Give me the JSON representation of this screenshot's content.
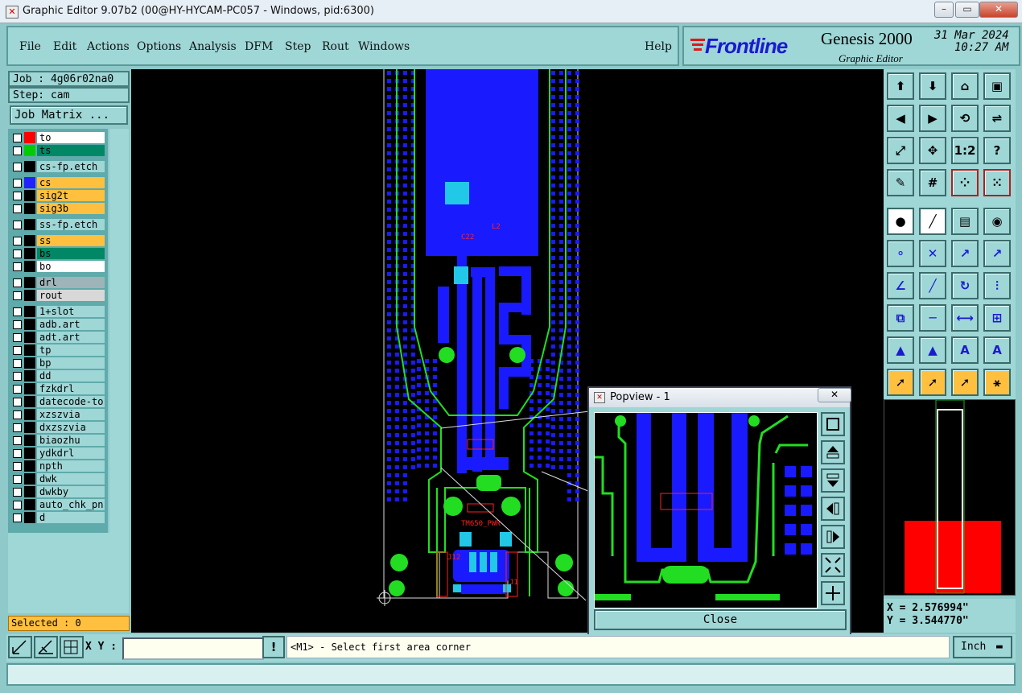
{
  "window": {
    "title": "Graphic Editor 9.07b2 (00@HY-HYCAM-PC057 - Windows, pid:6300)"
  },
  "menu": {
    "items": [
      "File",
      "Edit",
      "Actions",
      "Options",
      "Analysis",
      "DFM",
      "Step",
      "Rout",
      "Windows"
    ],
    "help": "Help"
  },
  "brand": {
    "logo": "Frontline",
    "product": "Genesis 2000",
    "subtitle": "Graphic Editor",
    "date": "31 Mar 2024",
    "time": "10:27 AM"
  },
  "job": {
    "job_label": "Job : 4g06r02na0",
    "step_label": "Step: cam",
    "matrix_button": "Job Matrix ..."
  },
  "layers": [
    {
      "name": "to",
      "swatch": "#ff0000",
      "bg": "#ffffff"
    },
    {
      "name": "ts",
      "swatch": "#00cc00",
      "bg": "#008866"
    },
    {
      "name": "cs-fp.etch",
      "swatch": "#000000",
      "bg": "#9fd6d6"
    },
    {
      "name": "cs",
      "swatch": "#2222ff",
      "bg": "#ffc040"
    },
    {
      "name": "sig2t",
      "swatch": "#000000",
      "bg": "#ffc040"
    },
    {
      "name": "sig3b",
      "swatch": "#000000",
      "bg": "#ffc040"
    },
    {
      "name": "ss-fp.etch",
      "swatch": "#000000",
      "bg": "#9fd6d6"
    },
    {
      "name": "ss",
      "swatch": "#000000",
      "bg": "#ffc040"
    },
    {
      "name": "bs",
      "swatch": "#000000",
      "bg": "#008866"
    },
    {
      "name": "bo",
      "swatch": "#000000",
      "bg": "#ffffff"
    },
    {
      "name": "drl",
      "swatch": "#000000",
      "bg": "#9fb4b8"
    },
    {
      "name": "rout",
      "swatch": "#000000",
      "bg": "#d8d8d8"
    },
    {
      "name": "1+slot",
      "swatch": "#000000",
      "bg": "#9fd6d6"
    },
    {
      "name": "adb.art",
      "swatch": "#000000",
      "bg": "#9fd6d6"
    },
    {
      "name": "adt.art",
      "swatch": "#000000",
      "bg": "#9fd6d6"
    },
    {
      "name": "tp",
      "swatch": "#000000",
      "bg": "#9fd6d6"
    },
    {
      "name": "bp",
      "swatch": "#000000",
      "bg": "#9fd6d6"
    },
    {
      "name": "dd",
      "swatch": "#000000",
      "bg": "#9fd6d6"
    },
    {
      "name": "fzkdrl",
      "swatch": "#000000",
      "bg": "#9fd6d6"
    },
    {
      "name": "datecode-to",
      "swatch": "#000000",
      "bg": "#9fd6d6"
    },
    {
      "name": "xzszvia",
      "swatch": "#000000",
      "bg": "#9fd6d6"
    },
    {
      "name": "dxzszvia",
      "swatch": "#000000",
      "bg": "#9fd6d6"
    },
    {
      "name": "biaozhu",
      "swatch": "#000000",
      "bg": "#9fd6d6"
    },
    {
      "name": "ydkdrl",
      "swatch": "#000000",
      "bg": "#9fd6d6"
    },
    {
      "name": "npth",
      "swatch": "#000000",
      "bg": "#9fd6d6"
    },
    {
      "name": "dwk",
      "swatch": "#000000",
      "bg": "#9fd6d6"
    },
    {
      "name": "dwkby",
      "swatch": "#000000",
      "bg": "#9fd6d6"
    },
    {
      "name": "auto_chk_pn",
      "swatch": "#000000",
      "bg": "#9fd6d6"
    },
    {
      "name": "d",
      "swatch": "#000000",
      "bg": "#9fd6d6"
    }
  ],
  "selected": {
    "label": "Selected : 0"
  },
  "popview": {
    "title": "Popview - 1",
    "close": "Close"
  },
  "coords": {
    "x": "X = 2.576994\"",
    "y": "Y = 3.544770\""
  },
  "bottom": {
    "xy_label": "X Y :",
    "xy_value": "",
    "prompt": "<M1> - Select first area corner",
    "units": "Inch"
  },
  "pcb_labels": {
    "ant": "TM650_PWR",
    "j12": "J12",
    "j1": "J1",
    "l2": "L2",
    "c22": "C22"
  },
  "colors": {
    "accent": "#9fd6d6",
    "copper": "#1a1aff",
    "outline": "#22dd22",
    "text_red": "#ff2020"
  }
}
